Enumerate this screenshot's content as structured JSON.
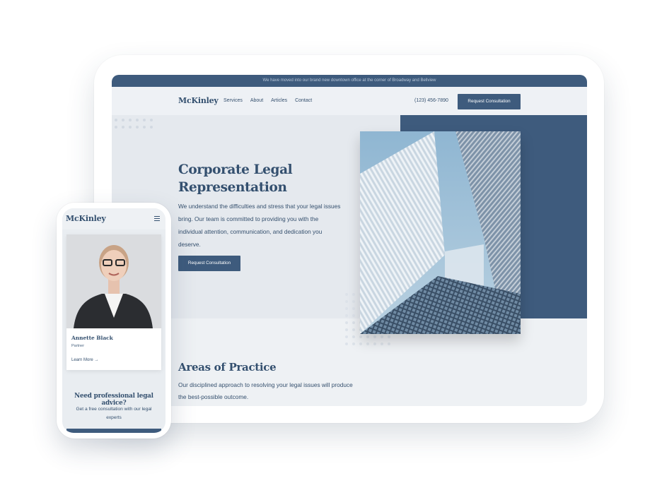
{
  "desktop": {
    "announcement": "We have moved into our brand new downtown office at the corner of Broadway and Bellview",
    "logo": "McKinley",
    "nav": [
      "Services",
      "About",
      "Articles",
      "Contact"
    ],
    "phone": "(123) 456-7890",
    "cta_button": "Request Consultation",
    "hero": {
      "title": "Corporate Legal Representation",
      "text": "We understand the difficulties and stress that your legal issues bring. Our team is committed to providing you with the individual attention, communication, and dedication you deserve.",
      "button": "Request Consultation"
    },
    "areas": {
      "title": "Areas of Practice",
      "text": "Our disciplined approach to resolving your legal issues will produce the best-possible outcome."
    }
  },
  "mobile": {
    "logo": "McKinley",
    "attorney": {
      "name": "Annette Black",
      "role": "Partner",
      "link": "Learn More"
    },
    "cta": {
      "title": "Need professional legal advice?",
      "text": "Get a free consultation with our legal experts"
    }
  },
  "colors": {
    "primary": "#3e5b7d",
    "heading": "#34506f",
    "background": "#eef1f4"
  }
}
